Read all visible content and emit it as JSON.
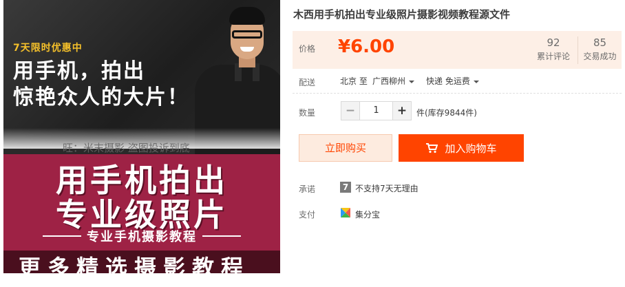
{
  "banner": {
    "promo_tag": "7天限时优惠中",
    "headline_line1": "用手机，拍出",
    "headline_line2": "惊艳众人的大片！",
    "watermark": "旺：米末摄影 盗图投诉到底",
    "big_title_line1": "用手机拍出",
    "big_title_line2": "专业级照片",
    "subtitle": "专业手机摄影教程",
    "bottom_text": "更多精选摄影教程"
  },
  "product": {
    "title": "木西用手机拍出专业级照片摄影视频教程源文件"
  },
  "price": {
    "label": "价格",
    "value": "¥6.00",
    "reviews_count": "92",
    "reviews_label": "累计评论",
    "sales_count": "85",
    "sales_label": "交易成功"
  },
  "delivery": {
    "label": "配送",
    "from": "北京 至",
    "to": "广西柳州",
    "method": "快递 免运费"
  },
  "quantity": {
    "label": "数量",
    "minus": "−",
    "value": "1",
    "plus": "+",
    "stock": "件(库存9844件)"
  },
  "actions": {
    "buy_now": "立即购买",
    "add_to_cart": "加入购物车"
  },
  "promise": {
    "label": "承诺",
    "badge": "7",
    "text": "不支持7天无理由"
  },
  "payment": {
    "label": "支付",
    "method": "集分宝"
  },
  "colors": {
    "accent": "#ff4400",
    "price_bg": "#fdefe6",
    "banner_magenta": "#9e2245",
    "promo_yellow": "#f6c12a"
  },
  "icons": [
    "cart-icon",
    "chevron-down-icon",
    "jifenbao-icon",
    "seven-day-icon"
  ]
}
